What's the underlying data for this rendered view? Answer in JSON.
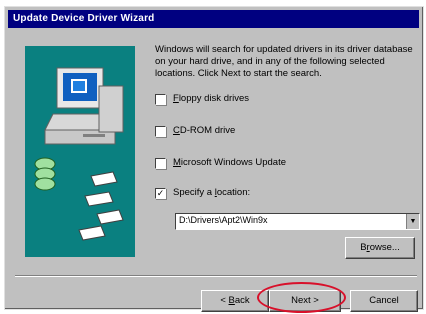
{
  "window": {
    "title": "Update Device Driver Wizard"
  },
  "description": "Windows will search for updated drivers in its driver database on your hard drive, and in any of the following selected locations. Click Next to start the search.",
  "options": [
    {
      "label_pre": "",
      "label_key": "F",
      "label_post": "loppy disk drives",
      "checked": false
    },
    {
      "label_pre": "",
      "label_key": "C",
      "label_post": "D-ROM drive",
      "checked": false
    },
    {
      "label_pre": "",
      "label_key": "M",
      "label_post": "icrosoft Windows Update",
      "checked": false
    },
    {
      "label_pre": "Specify a ",
      "label_key": "l",
      "label_post": "ocation:",
      "checked": true,
      "mark": "✓"
    }
  ],
  "location": {
    "value": "D:\\Drivers\\Apt2\\Win9x",
    "arrow": "▼"
  },
  "buttons": {
    "browse": {
      "pre": "B",
      "key": "r",
      "post": "owse..."
    },
    "back": {
      "pre": "< ",
      "key": "B",
      "post": "ack"
    },
    "next": {
      "label": "Next >"
    },
    "cancel": {
      "label": "Cancel"
    }
  },
  "colors": {
    "titlebar": "#000080",
    "graphic_bg": "#0a8080",
    "highlight_ring": "#d8102a"
  }
}
